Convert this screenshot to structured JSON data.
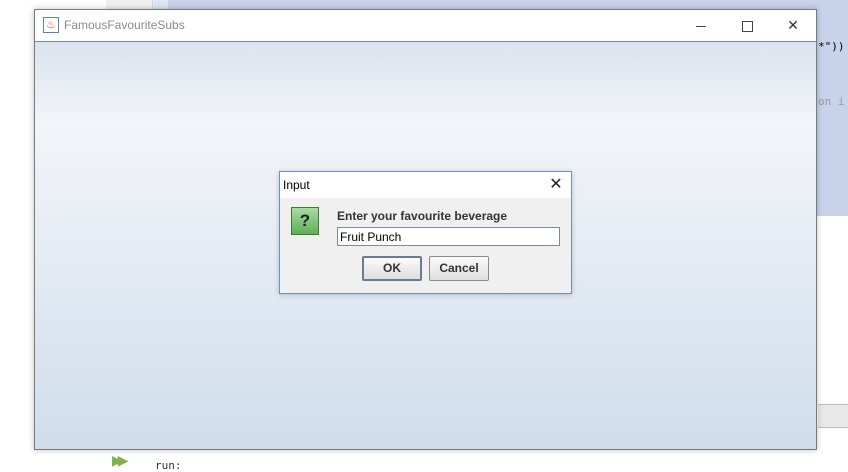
{
  "ide": {
    "code_fragment_1": "*\"))",
    "code_fragment_2": "on i",
    "run_label": "run:"
  },
  "window": {
    "title": "FamousFavouriteSubs",
    "icon": "java-cup-icon",
    "controls": [
      "minimize",
      "maximize",
      "close"
    ]
  },
  "dialog": {
    "title": "Input",
    "icon": "question-icon",
    "prompt": "Enter your favourite beverage",
    "input_value": "Fruit Punch",
    "ok_label": "OK",
    "cancel_label": "Cancel"
  },
  "colors": {
    "dialog_border": "#6d8fc7",
    "question_icon_green": "#5fae58",
    "editor_selection": "#c8d3ea"
  }
}
